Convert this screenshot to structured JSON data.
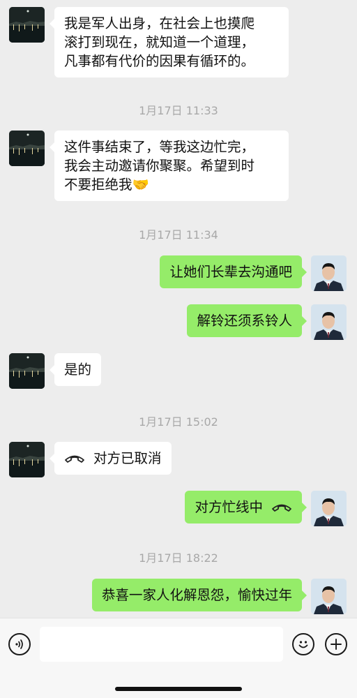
{
  "messages": [
    {
      "text": "我是军人出身，在社会上也摸爬\n滚打到现在，就知道一个道理，\n凡事都有代价的因果有循环的。"
    },
    {
      "timestamp": "1月17日 11:33"
    },
    {
      "text": "这件事结束了，等我这边忙完，\n我会主动邀请你聚聚。希望到时\n不要拒绝我🤝"
    },
    {
      "timestamp": "1月17日 11:34"
    },
    {
      "text": "让她们长辈去沟通吧"
    },
    {
      "text": "解铃还须系铃人"
    },
    {
      "text": "是的"
    },
    {
      "timestamp": "1月17日 15:02"
    },
    {
      "text": "对方已取消",
      "icon": "phone-hangup-icon"
    },
    {
      "text": "对方忙线中",
      "icon": "phone-hangup-icon"
    },
    {
      "timestamp": "1月17日 18:22"
    },
    {
      "text": "恭喜一家人化解恩怨，愉快过年"
    }
  ],
  "composer": {
    "voice_icon": "voice-input-icon",
    "emoji_icon": "emoji-icon",
    "plus_icon": "plus-icon"
  },
  "colors": {
    "background": "#ededed",
    "sent_bubble": "#95ec69",
    "received_bubble": "#ffffff",
    "timestamp": "#a8a8a8"
  }
}
